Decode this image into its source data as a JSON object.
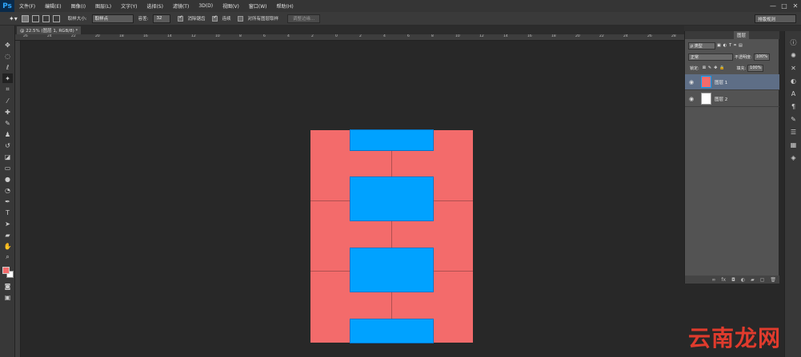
{
  "app": {
    "logo": "Ps"
  },
  "menu": [
    "文件(F)",
    "编辑(E)",
    "图像(I)",
    "图层(L)",
    "文字(Y)",
    "选择(S)",
    "滤镜(T)",
    "3D(D)",
    "视图(V)",
    "窗口(W)",
    "帮助(H)"
  ],
  "window_controls": [
    "—",
    "□",
    "✕"
  ],
  "options": {
    "sample_size_label": "取样大小:",
    "sample_size_value": "取样点",
    "tolerance_label": "容差:",
    "tolerance_value": "32",
    "antialias_label": "消除锯齿",
    "contiguous_label": "连续",
    "sample_all_label": "对所有图层取样",
    "refine_edge_label": "调整边缘...",
    "workspace": "排版规则"
  },
  "document": {
    "tab_label": "@ 22.5% (图层 1, RGB/8) *"
  },
  "ruler": [
    "26",
    "24",
    "22",
    "20",
    "18",
    "16",
    "14",
    "12",
    "10",
    "8",
    "6",
    "4",
    "2",
    "0",
    "2",
    "4",
    "6",
    "8",
    "10",
    "12",
    "14",
    "16",
    "18",
    "20",
    "22",
    "24",
    "26",
    "28"
  ],
  "layers_panel": {
    "title": "图层",
    "filter_kind": "ρ 类型",
    "blend_mode": "正常",
    "opacity_label": "不透明度:",
    "opacity_value": "100%",
    "lock_label": "锁定:",
    "fill_label": "填充:",
    "fill_value": "100%",
    "layers": [
      {
        "name": "图层 1",
        "selected": true
      },
      {
        "name": "图层 2",
        "selected": false
      }
    ]
  },
  "watermark": "云南龙网",
  "colors": {
    "brick_red": "#f36b6b",
    "block_blue": "#00a2ff",
    "foreground": "#f36b6b",
    "background": "#ffffff"
  }
}
